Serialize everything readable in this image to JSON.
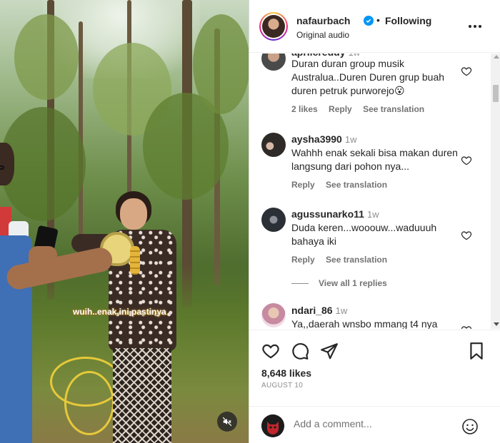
{
  "post": {
    "sticker_text": "wuih..enak ini pastinya"
  },
  "header": {
    "username": "nafaurbach",
    "separator": "•",
    "follow_state": "Following",
    "audio": "Original audio"
  },
  "comments": [
    {
      "username": "aprilcreddy",
      "time": "1w",
      "text": "Duran duran group musik Australua..Duren Duren grup buah duren petruk purworejo😮",
      "likes": "2 likes",
      "reply": "Reply",
      "translate": "See translation"
    },
    {
      "username": "aysha3990",
      "time": "1w",
      "text": "Wahhh enak sekali bisa makan duren langsung dari pohon nya...",
      "reply": "Reply",
      "translate": "See translation"
    },
    {
      "username": "agussunarko11",
      "time": "1w",
      "text": "Duda keren...wooouw...waduuuh bahaya iki",
      "reply": "Reply",
      "translate": "See translation",
      "view_replies": "View all 1 replies"
    },
    {
      "username": "ndari_86",
      "time": "1w",
      "text": "Ya,,daerah wnsbo mmang t4 nya"
    }
  ],
  "actions": {
    "likes": "8,648 likes",
    "date": "AUGUST 10"
  },
  "add_comment": {
    "placeholder": "Add a comment..."
  },
  "icons": {
    "like": "heart-icon",
    "comment": "comment-icon",
    "share": "share-icon",
    "save": "bookmark-icon",
    "more": "more-icon",
    "mute": "muted-speaker-icon",
    "emoji": "emoji-icon",
    "verified": "verified-badge-icon"
  },
  "colors": {
    "verified_blue": "#0095f6",
    "text_primary": "#262626",
    "text_secondary": "#737373"
  }
}
